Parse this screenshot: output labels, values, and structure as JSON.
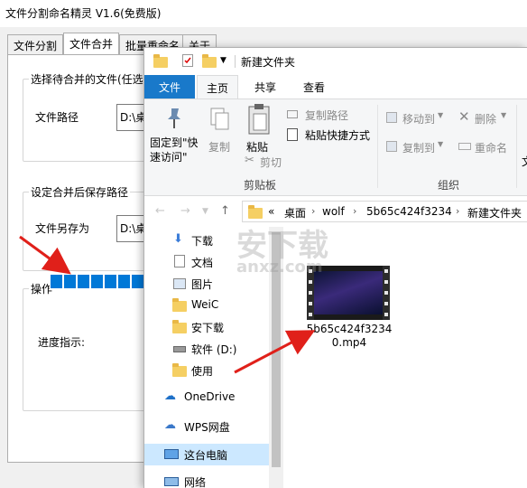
{
  "bg": {
    "title": "文件分割命名精灵 V1.6(免费版)",
    "tabs": [
      "文件分割",
      "文件合并",
      "批量重命名",
      "关于"
    ],
    "merge_group_title": "选择待合并的文件(任选",
    "path_label": "文件路径",
    "path_value": "D:\\桌",
    "save_group_title": "设定合并后保存路径",
    "saveas_label": "文件另存为",
    "saveas_value": "D:\\桌",
    "ops_title": "操作",
    "progress_label": "进度指示:",
    "progress_fraction": 0.4
  },
  "explorer": {
    "title": "新建文件夹",
    "menu": [
      "文件",
      "主页",
      "共享",
      "查看"
    ],
    "ribbon": {
      "pin": "固定到\"快\n速访问\"",
      "copy": "复制",
      "paste": "粘贴",
      "copy_path": "复制路径",
      "paste_shortcut": "粘贴快捷方式",
      "cut": "剪切",
      "clipboard_group": "剪贴板",
      "move_to": "移动到",
      "copy_to": "复制到",
      "delete": "删除",
      "rename": "重命名",
      "organize_group": "组织",
      "overflow": "文"
    },
    "address": {
      "crumbs": [
        "桌面",
        "wolf",
        "5b65c424f3234",
        "新建文件夹"
      ],
      "prefix": "«"
    },
    "nav": [
      {
        "label": "下载",
        "icon": "download-icon"
      },
      {
        "label": "文档",
        "icon": "document-icon"
      },
      {
        "label": "图片",
        "icon": "picture-icon"
      },
      {
        "label": "WeiC",
        "icon": "folder-icon"
      },
      {
        "label": "安下载",
        "icon": "folder-icon"
      },
      {
        "label": "软件 (D:)",
        "icon": "drive-icon"
      },
      {
        "label": "使用",
        "icon": "folder-icon"
      },
      {
        "label": "OneDrive",
        "icon": "cloud-icon"
      },
      {
        "label": "WPS网盘",
        "icon": "cloud-icon"
      },
      {
        "label": "这台电脑",
        "icon": "computer-icon"
      },
      {
        "label": "网络",
        "icon": "network-icon"
      }
    ],
    "file": {
      "name_line1": "5b65c424f3234",
      "name_line2": "0.mp4"
    }
  },
  "watermark": {
    "main": "安下载",
    "sub": "anxz.com"
  },
  "colors": {
    "accent": "#1979ca",
    "progress": "#0078d7",
    "arrow": "#e0201a",
    "selected": "#cce8ff"
  }
}
